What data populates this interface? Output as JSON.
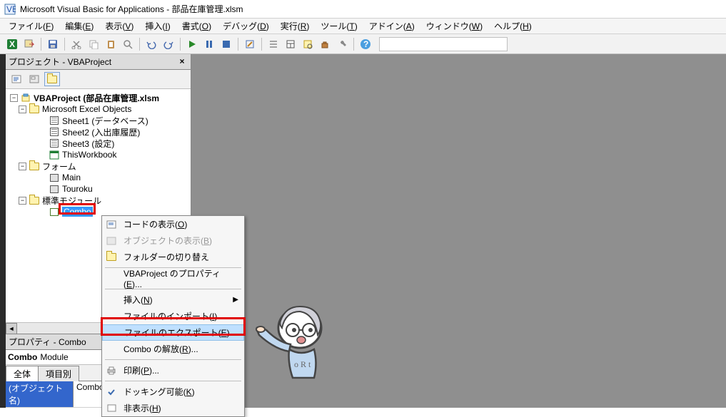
{
  "title": "Microsoft Visual Basic for Applications - 部品在庫管理.xlsm",
  "menus": {
    "file": "ファイル(F)",
    "edit": "編集(E)",
    "view": "表示(V)",
    "insert": "挿入(I)",
    "format": "書式(O)",
    "debug": "デバッグ(D)",
    "run": "実行(R)",
    "tools": "ツール(T)",
    "addins": "アドイン(A)",
    "window": "ウィンドウ(W)",
    "help": "ヘルプ(H)"
  },
  "panes": {
    "project_title": "プロジェクト - VBAProject",
    "props_title": "プロパティ - Combo"
  },
  "tree": {
    "root": "VBAProject (部品在庫管理.xlsm",
    "excel_objects": "Microsoft Excel Objects",
    "sheet1": "Sheet1 (データベース)",
    "sheet2": "Sheet2 (入出庫履歴)",
    "sheet3": "Sheet3 (設定)",
    "thisworkbook": "ThisWorkbook",
    "forms": "フォーム",
    "form_main": "Main",
    "form_touroku": "Touroku",
    "modules": "標準モジュール",
    "module_combo": "Combo"
  },
  "props": {
    "combo_name": "Combo",
    "combo_type": "Module",
    "tab_all": "全体",
    "tab_by_item": "項目別",
    "row_key": "(オブジェクト名)",
    "row_val": "Combo"
  },
  "context": {
    "show_code": "コードの表示(O)",
    "show_object": "オブジェクトの表示(B)",
    "toggle_folder": "フォルダーの切り替え",
    "vba_props": "VBAProject のプロパティ(E)...",
    "insert": "挿入(N)",
    "import": "ファイルのインポート(I)...",
    "export": "ファイルのエクスポート(E)...",
    "remove": "Combo の解放(R)...",
    "print": "印刷(P)...",
    "docking": "ドッキング可能(K)",
    "hide": "非表示(H)"
  }
}
